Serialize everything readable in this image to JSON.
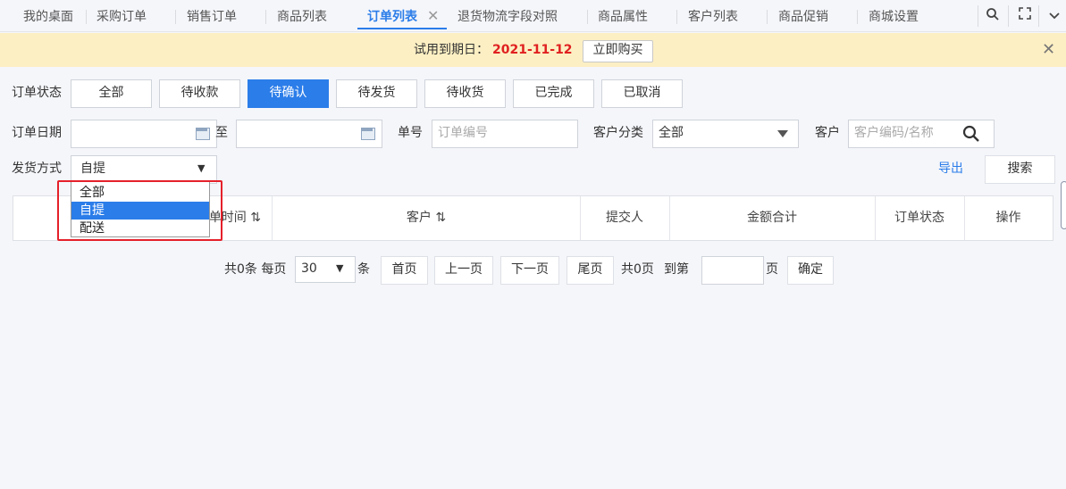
{
  "tabs": [
    {
      "label": "我的桌面"
    },
    {
      "label": "采购订单"
    },
    {
      "label": "销售订单"
    },
    {
      "label": "商品列表"
    },
    {
      "label": "订单列表",
      "active": true
    },
    {
      "label": "退货物流字段对照"
    },
    {
      "label": "商品属性"
    },
    {
      "label": "客户列表"
    },
    {
      "label": "商品促销"
    },
    {
      "label": "商城设置"
    }
  ],
  "notice": {
    "label": "试用到期日：",
    "date": "2021-11-12",
    "buy_button": "立即购买"
  },
  "filters": {
    "status_label": "订单状态",
    "status_buttons": [
      "全部",
      "待收款",
      "待确认",
      "待发货",
      "待收货",
      "已完成",
      "已取消"
    ],
    "active_status": "待确认",
    "date_label": "订单日期",
    "to_label": "至",
    "order_no_label": "单号",
    "order_no_placeholder": "订单编号",
    "customer_category_label": "客户分类",
    "customer_category_value": "全部",
    "customer_label": "客户",
    "customer_placeholder": "客户编码/名称",
    "shipping_label": "发货方式",
    "shipping_value": "自提",
    "shipping_options": [
      "全部",
      "自提",
      "配送"
    ],
    "shipping_highlighted": "自提",
    "export_link": "导出",
    "search_button": "搜索"
  },
  "table": {
    "columns": [
      "单时间 ⇅",
      "客户 ⇅",
      "提交人",
      "金额合计",
      "订单状态",
      "操作"
    ]
  },
  "pagination": {
    "total_text": "共0条 每页",
    "page_size": "30",
    "unit": "条",
    "first": "首页",
    "prev": "上一页",
    "next": "下一页",
    "last": "尾页",
    "pages_text": "共0页",
    "goto_text": "到第",
    "page_suffix": "页",
    "confirm": "确定"
  },
  "colors": {
    "accent": "#2b7de9",
    "notice_bg": "#fcefc3",
    "date_red": "#e02020",
    "highlight_red": "#e5202a"
  }
}
